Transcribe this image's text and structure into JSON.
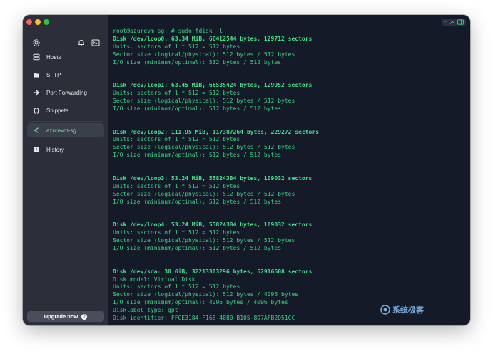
{
  "sidebar": {
    "items": [
      {
        "label": "Hosts",
        "icon": "hosts-icon"
      },
      {
        "label": "SFTP",
        "icon": "folder-icon"
      },
      {
        "label": "Port Forwarding",
        "icon": "arrow-right-icon"
      },
      {
        "label": "Snippets",
        "icon": "braces-icon"
      }
    ],
    "active_host": {
      "label": "azurevm-sg",
      "icon": "terminal-icon"
    },
    "history": {
      "label": "History",
      "icon": "clock-icon"
    },
    "upgrade_label": "Upgrade now",
    "upgrade_icon_glyph": "?"
  },
  "terminal": {
    "lines": [
      {
        "text": "root@azurevm-sg:~# sudo fdisk -l",
        "style": "prompt"
      },
      {
        "text": "Disk /dev/loop0: 63.34 MiB, 66412544 bytes, 129712 sectors",
        "style": "bold"
      },
      {
        "text": "Units: sectors of 1 * 512 = 512 bytes",
        "style": "normal"
      },
      {
        "text": "Sector size (logical/physical): 512 bytes / 512 bytes",
        "style": "normal"
      },
      {
        "text": "I/O size (minimum/optimal): 512 bytes / 512 bytes",
        "style": "normal"
      },
      {
        "text": "",
        "style": "normal"
      },
      {
        "text": "",
        "style": "normal"
      },
      {
        "text": "Disk /dev/loop1: 63.45 MiB, 66535424 bytes, 129952 sectors",
        "style": "bold"
      },
      {
        "text": "Units: sectors of 1 * 512 = 512 bytes",
        "style": "normal"
      },
      {
        "text": "Sector size (logical/physical): 512 bytes / 512 bytes",
        "style": "normal"
      },
      {
        "text": "I/O size (minimum/optimal): 512 bytes / 512 bytes",
        "style": "normal"
      },
      {
        "text": "",
        "style": "normal"
      },
      {
        "text": "",
        "style": "normal"
      },
      {
        "text": "Disk /dev/loop2: 111.95 MiB, 117387264 bytes, 229272 sectors",
        "style": "bold"
      },
      {
        "text": "Units: sectors of 1 * 512 = 512 bytes",
        "style": "normal"
      },
      {
        "text": "Sector size (logical/physical): 512 bytes / 512 bytes",
        "style": "normal"
      },
      {
        "text": "I/O size (minimum/optimal): 512 bytes / 512 bytes",
        "style": "normal"
      },
      {
        "text": "",
        "style": "normal"
      },
      {
        "text": "",
        "style": "normal"
      },
      {
        "text": "Disk /dev/loop3: 53.24 MiB, 55824384 bytes, 109032 sectors",
        "style": "bold"
      },
      {
        "text": "Units: sectors of 1 * 512 = 512 bytes",
        "style": "normal"
      },
      {
        "text": "Sector size (logical/physical): 512 bytes / 512 bytes",
        "style": "normal"
      },
      {
        "text": "I/O size (minimum/optimal): 512 bytes / 512 bytes",
        "style": "normal"
      },
      {
        "text": "",
        "style": "normal"
      },
      {
        "text": "",
        "style": "normal"
      },
      {
        "text": "Disk /dev/loop4: 53.24 MiB, 55824384 bytes, 109032 sectors",
        "style": "bold"
      },
      {
        "text": "Units: sectors of 1 * 512 = 512 bytes",
        "style": "normal"
      },
      {
        "text": "Sector size (logical/physical): 512 bytes / 512 bytes",
        "style": "normal"
      },
      {
        "text": "I/O size (minimum/optimal): 512 bytes / 512 bytes",
        "style": "normal"
      },
      {
        "text": "",
        "style": "normal"
      },
      {
        "text": "",
        "style": "normal"
      },
      {
        "text": "Disk /dev/sda: 30 GiB, 32213303296 bytes, 62916608 sectors",
        "style": "bold"
      },
      {
        "text": "Disk model: Virtual Disk",
        "style": "normal"
      },
      {
        "text": "Units: sectors of 1 * 512 = 512 bytes",
        "style": "normal"
      },
      {
        "text": "Sector size (logical/physical): 512 bytes / 4096 bytes",
        "style": "normal"
      },
      {
        "text": "I/O size (minimum/optimal): 4096 bytes / 4096 bytes",
        "style": "normal"
      },
      {
        "text": "Disklabel type: gpt",
        "style": "normal"
      },
      {
        "text": "Disk identifier: FFCE3184-F168-4880-B105-8D7AFB2D51CC",
        "style": "normal"
      }
    ]
  },
  "watermark": {
    "text": "系统极客"
  },
  "colors": {
    "sidebar_bg": "#2c2f3a",
    "terminal_bg": "#151a29",
    "terminal_text": "#36d47f",
    "active_accent": "#7fe3a0"
  }
}
